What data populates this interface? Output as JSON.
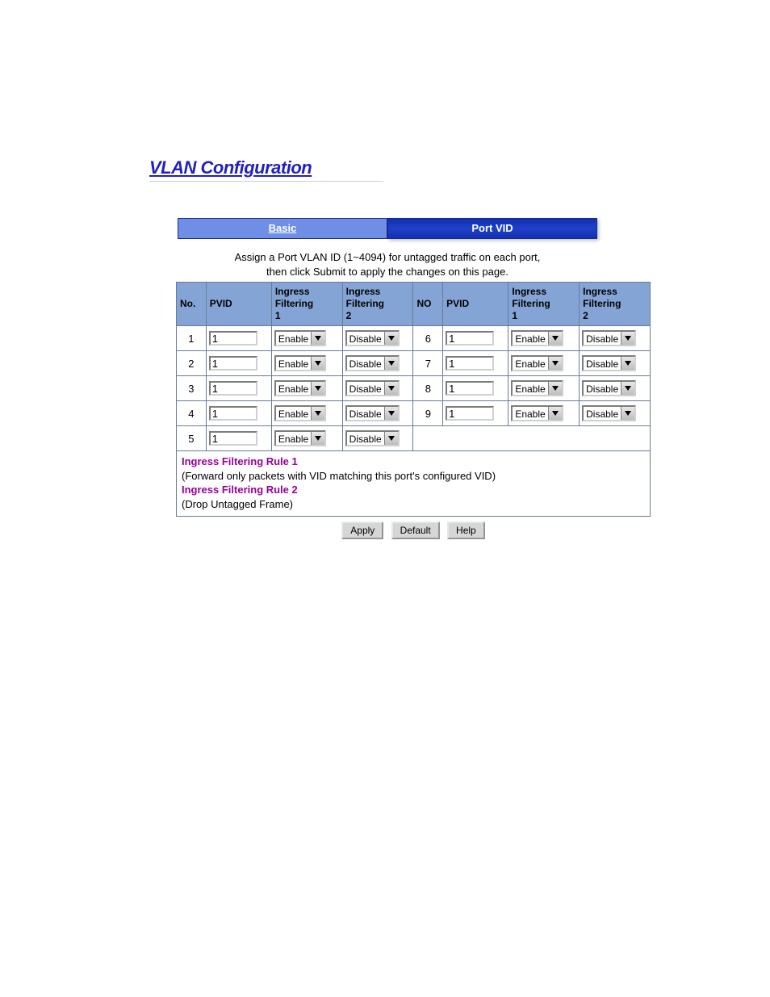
{
  "title": "VLAN Configuration",
  "tabs": {
    "basic": "Basic",
    "portvid": "Port VID"
  },
  "intro1": "Assign a Port VLAN ID (1~4094) for untagged traffic on each port,",
  "intro2": "then click Submit to apply the changes on this page.",
  "headers": {
    "no": "No.",
    "pvid": "PVID",
    "if1": "Ingress Filtering 1",
    "if2": "Ingress Filtering 2",
    "no2": "NO",
    "pvid2": "PVID",
    "if1b": "Ingress Filtering 1",
    "if2b": "Ingress Filtering 2"
  },
  "ports": [
    {
      "no": "1",
      "pvid": "1",
      "f1": "Enable",
      "f2": "Disable"
    },
    {
      "no": "2",
      "pvid": "1",
      "f1": "Enable",
      "f2": "Disable"
    },
    {
      "no": "3",
      "pvid": "1",
      "f1": "Enable",
      "f2": "Disable"
    },
    {
      "no": "4",
      "pvid": "1",
      "f1": "Enable",
      "f2": "Disable"
    },
    {
      "no": "5",
      "pvid": "1",
      "f1": "Enable",
      "f2": "Disable"
    },
    {
      "no": "6",
      "pvid": "1",
      "f1": "Enable",
      "f2": "Disable"
    },
    {
      "no": "7",
      "pvid": "1",
      "f1": "Enable",
      "f2": "Disable"
    },
    {
      "no": "8",
      "pvid": "1",
      "f1": "Enable",
      "f2": "Disable"
    },
    {
      "no": "9",
      "pvid": "1",
      "f1": "Enable",
      "f2": "Disable"
    }
  ],
  "rules": {
    "r1h": "Ingress Filtering Rule 1",
    "r1d": "(Forward only packets with VID matching this port's configured VID)",
    "r2h": "Ingress Filtering Rule 2",
    "r2d": "(Drop Untagged Frame)"
  },
  "buttons": {
    "apply": "Apply",
    "default": "Default",
    "help": "Help"
  }
}
